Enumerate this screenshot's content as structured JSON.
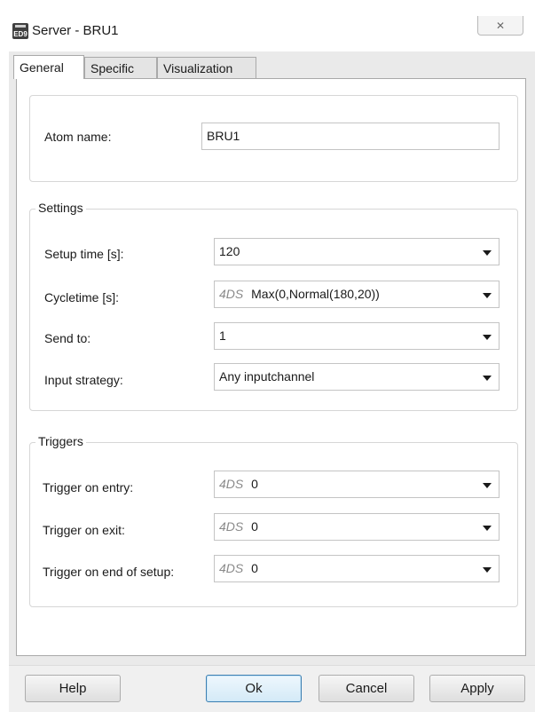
{
  "window": {
    "title": "Server - BRU1",
    "app_icon": "ED9",
    "close_symbol": "✕"
  },
  "tabs": [
    {
      "label": "General",
      "active": true
    },
    {
      "label": "Specific",
      "active": false
    },
    {
      "label": "Visualization",
      "active": false
    }
  ],
  "atom": {
    "label": "Atom name:",
    "value": "BRU1"
  },
  "settings": {
    "legend": "Settings",
    "setup_time": {
      "label": "Setup time [s]:",
      "value": "120"
    },
    "cycletime": {
      "label": "Cycletime [s]:",
      "prefix": "4DS",
      "value": "Max(0,Normal(180,20))"
    },
    "send_to": {
      "label": "Send to:",
      "value": "1"
    },
    "input_strategy": {
      "label": "Input strategy:",
      "value": "Any inputchannel"
    }
  },
  "triggers": {
    "legend": "Triggers",
    "on_entry": {
      "label": "Trigger on entry:",
      "prefix": "4DS",
      "value": "0"
    },
    "on_exit": {
      "label": "Trigger on exit:",
      "prefix": "4DS",
      "value": "0"
    },
    "on_end_setup": {
      "label": "Trigger on end of setup:",
      "prefix": "4DS",
      "value": "0"
    }
  },
  "buttons": {
    "help": "Help",
    "ok": "Ok",
    "cancel": "Cancel",
    "apply": "Apply"
  }
}
